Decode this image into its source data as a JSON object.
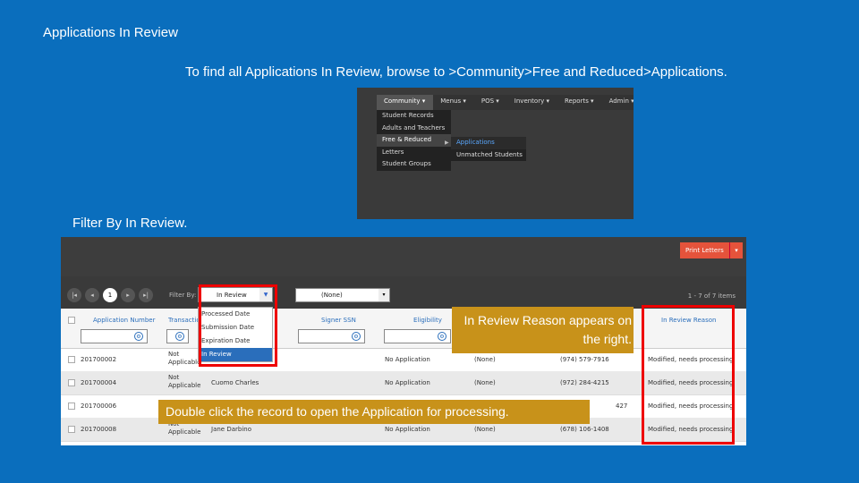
{
  "slide": {
    "title": "Applications In Review",
    "instruction_browse": "To find all Applications In Review, browse to >Community>Free and Reduced>Applications.",
    "instruction_filter": "Filter By In Review.",
    "callout_reason": "In Review Reason appears on the right.",
    "callout_double_click": "Double click the record to open the Application for processing."
  },
  "menu": {
    "bar": [
      "Community ▾",
      "Menus ▾",
      "POS ▾",
      "Inventory ▾",
      "Reports ▾",
      "Admin ▾"
    ],
    "community_items": [
      "Student Records",
      "Adults and Teachers",
      "Free & Reduced",
      "Letters",
      "Student Groups"
    ],
    "free_reduced_items": [
      "Applications",
      "Unmatched Students"
    ]
  },
  "toolbar": {
    "print_letters": "Print Letters",
    "caret": "▾",
    "filter_by_label": "Filter By:",
    "filter_value": "In Review",
    "none_value": "(None)",
    "item_count": "1 - 7 of 7 items",
    "page_current": "1",
    "pager_first": "|◂",
    "pager_prev": "◂",
    "pager_next": "▸",
    "pager_last": "▸|"
  },
  "filter_options": [
    "Processed Date",
    "Submission Date",
    "Expiration Date",
    "In Review"
  ],
  "grid": {
    "headers": [
      "Application Number",
      "Transaction",
      "Signer SSN",
      "Eligibility",
      "In Review Reason"
    ],
    "rows": [
      {
        "app": "201700002",
        "transaction": "Not Applicable",
        "name": "",
        "eligibility": "No Application",
        "status": "(None)",
        "phone": "(974) 579-7916",
        "reason": "Modified, needs processing"
      },
      {
        "app": "201700004",
        "transaction": "Not Applicable",
        "name": "Cuomo Charles",
        "eligibility": "No Application",
        "status": "(None)",
        "phone": "(972) 284-4215",
        "reason": "Modified, needs processing"
      },
      {
        "app": "201700006",
        "transaction": "",
        "name": "",
        "eligibility": "",
        "status": "",
        "phone": "427",
        "reason": "Modified, needs processing"
      },
      {
        "app": "201700008",
        "transaction": "Not Applicable",
        "name": "Jane Darbino",
        "eligibility": "No Application",
        "status": "(None)",
        "phone": "(678) 106-1408",
        "reason": "Modified, needs processing"
      }
    ]
  },
  "colors": {
    "background": "#0a6ebd",
    "callout": "#c8921a",
    "highlight": "#e00000"
  }
}
